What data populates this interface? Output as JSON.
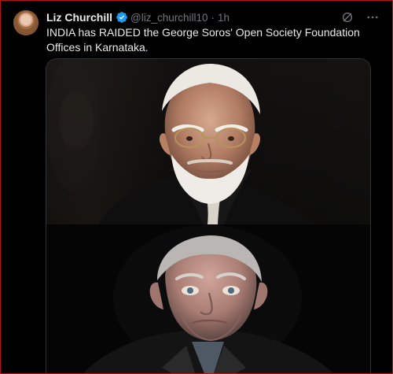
{
  "tweet": {
    "author": {
      "display_name": "Liz Churchill",
      "handle": "@liz_churchill10",
      "verified": true
    },
    "separator": "·",
    "timestamp": "1h",
    "text": "INDIA has RAIDED the George Soros' Open Society Foundation Offices in Karnataka.",
    "icons": {
      "verified": "verified-badge-icon",
      "grok": "grok-icon",
      "more": "more-options-icon"
    }
  },
  "colors": {
    "background": "#000000",
    "frame_border": "#b3141b",
    "primary_text": "#e7e9ea",
    "secondary_text": "#71767b",
    "verified_blue": "#1d9bf0",
    "media_border": "#2f3336"
  }
}
